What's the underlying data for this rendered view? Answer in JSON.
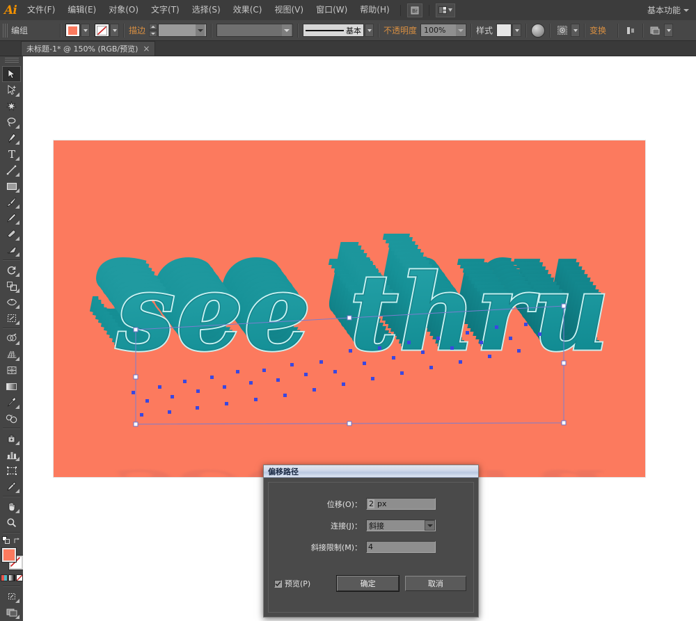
{
  "app": {
    "logo_text": "Ai",
    "workspace": "基本功能"
  },
  "menubar": {
    "items": [
      {
        "label": "文件(F)"
      },
      {
        "label": "编辑(E)"
      },
      {
        "label": "对象(O)"
      },
      {
        "label": "文字(T)"
      },
      {
        "label": "选择(S)"
      },
      {
        "label": "效果(C)"
      },
      {
        "label": "视图(V)"
      },
      {
        "label": "窗口(W)"
      },
      {
        "label": "帮助(H)"
      }
    ],
    "bridge_icon": "bridge-icon",
    "arrange_icon": "arrange-documents-icon"
  },
  "controlbar": {
    "selection_label": "编组",
    "fill_color": "#fc7a5e",
    "stroke_label": "描边",
    "stroke_weight": "",
    "stroke_profile": "",
    "brush_label": "基本",
    "opacity_label": "不透明度",
    "opacity_value": "100%",
    "style_label": "样式",
    "transform_label": "变换",
    "align_icon": "align-icon",
    "isolate_icon": "isolate-group-icon",
    "recolor_icon": "recolor-artwork-icon",
    "options_icon": "document-setup-icon"
  },
  "tabbar": {
    "document_tab": "未标题-1* @ 150% (RGB/预览)",
    "close_glyph": "×"
  },
  "toolbar": {
    "fill_color": "#fc7a5e",
    "stroke_color": "none",
    "tools": [
      {
        "name": "selection-tool",
        "active": true
      },
      {
        "name": "direct-selection-tool",
        "active": false
      },
      {
        "name": "magic-wand-tool",
        "active": false
      },
      {
        "name": "lasso-tool",
        "active": false
      },
      {
        "name": "pen-tool",
        "active": false
      },
      {
        "name": "type-tool",
        "active": false
      },
      {
        "name": "line-segment-tool",
        "active": false
      },
      {
        "name": "rectangle-tool",
        "active": false
      },
      {
        "name": "paintbrush-tool",
        "active": false
      },
      {
        "name": "pencil-tool",
        "active": false
      },
      {
        "name": "blob-brush-tool",
        "active": false
      },
      {
        "name": "eraser-tool",
        "active": false
      },
      {
        "name": "rotate-tool",
        "active": false
      },
      {
        "name": "scale-tool",
        "active": false
      },
      {
        "name": "width-tool",
        "active": false
      },
      {
        "name": "free-transform-tool",
        "active": false
      },
      {
        "name": "shape-builder-tool",
        "active": false
      },
      {
        "name": "perspective-grid-tool",
        "active": false
      },
      {
        "name": "mesh-tool",
        "active": false
      },
      {
        "name": "gradient-tool",
        "active": false
      },
      {
        "name": "eyedropper-tool",
        "active": false
      },
      {
        "name": "blend-tool",
        "active": false
      },
      {
        "name": "symbol-sprayer-tool",
        "active": false
      },
      {
        "name": "column-graph-tool",
        "active": false
      },
      {
        "name": "artboard-tool",
        "active": false
      },
      {
        "name": "slice-tool",
        "active": false
      },
      {
        "name": "hand-tool",
        "active": false
      },
      {
        "name": "zoom-tool",
        "active": false
      }
    ],
    "color_modes": [
      "color-swatch",
      "gradient-swatch",
      "none-swatch"
    ],
    "screen_mode_icon": "screen-mode-icon",
    "drawing_mode_icon": "drawing-mode-icon"
  },
  "artwork": {
    "background_color": "#fc7a5e",
    "text": "see thru",
    "text_fill": "#1e9aa0",
    "text_highlight": "#bff0f0",
    "extrude_color": "#0f7f86",
    "reflection_color": "#c4605f",
    "selection_stroke": "#7a7dd0",
    "anchor_fill": "#3a47e0"
  },
  "dialog": {
    "title": "偏移路径",
    "fields": [
      {
        "label": "位移(O)：",
        "value": "2",
        "unit": "px",
        "type": "text"
      },
      {
        "label": "连接(J)：",
        "value": "斜接",
        "type": "select"
      },
      {
        "label": "斜接限制(M)：",
        "value": "4",
        "type": "text"
      }
    ],
    "preview_label": "预览(P)",
    "preview_checked": true,
    "ok_label": "确定",
    "cancel_label": "取消"
  }
}
